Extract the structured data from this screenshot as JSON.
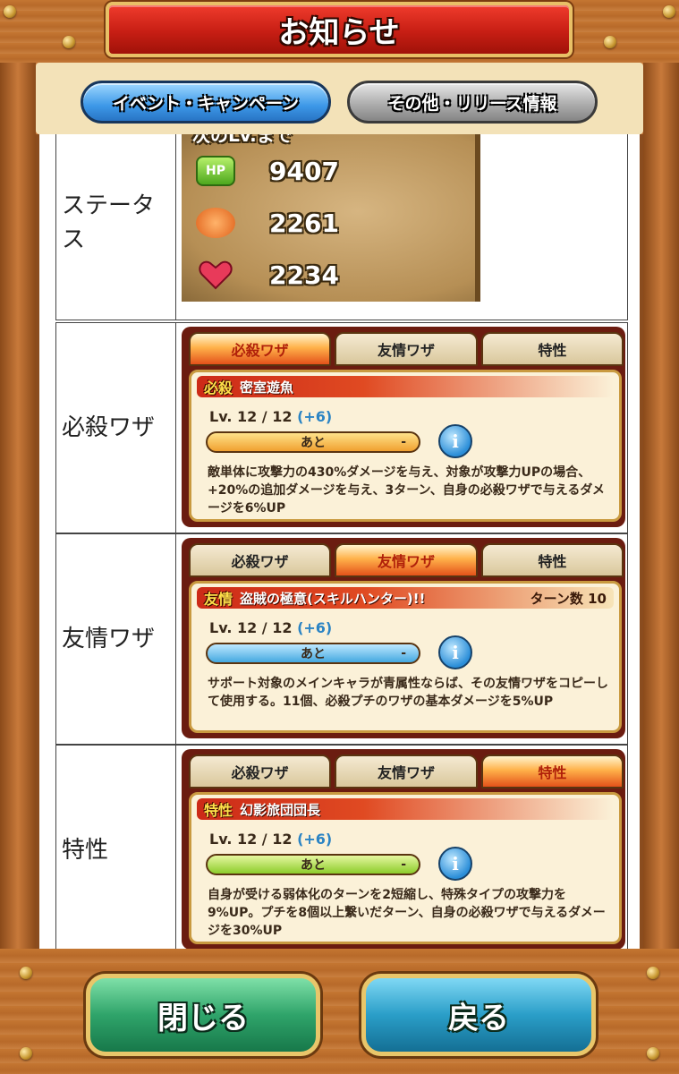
{
  "header": {
    "title": "お知らせ"
  },
  "tabs": [
    {
      "label": "イベント・キャンペーン",
      "active": true
    },
    {
      "label": "その他・リリース情報",
      "active": false
    }
  ],
  "status_row": {
    "label": "ステータス",
    "next_lv": "次のLv.まで",
    "next_lv_value": "-",
    "stats": [
      {
        "icon": "hp-icon",
        "icon_text": "HP",
        "value": "9407"
      },
      {
        "icon": "attack-fist-icon",
        "icon_text": "",
        "value": "2261"
      },
      {
        "icon": "heart-icon",
        "icon_text": "",
        "value": "2234"
      }
    ]
  },
  "skill_tabs": [
    "必殺ワザ",
    "友情ワザ",
    "特性"
  ],
  "special_row": {
    "label": "必殺ワザ",
    "badge": "必殺",
    "name": "密室遊魚",
    "lv": "Lv. 12 / 12",
    "plus": "(+6)",
    "bar_text": "あと",
    "bar_dash": "-",
    "desc": "敵単体に攻撃力の430%ダメージを与え、対象が攻撃力UPの場合、+20%の追加ダメージを与え、3ターン、自身の必殺ワザで与えるダメージを6%UP"
  },
  "friend_row": {
    "label": "友情ワザ",
    "badge": "友情",
    "name": "盗賊の極意(スキルハンター)!!",
    "turn": "ターン数 10",
    "lv": "Lv. 12 / 12",
    "plus": "(+6)",
    "bar_text": "あと",
    "bar_dash": "-",
    "desc": "サポート対象のメインキャラが青属性ならば、その友情ワザをコピーして使用する。11個、必殺プチのワザの基本ダメージを5%UP"
  },
  "trait_row": {
    "label": "特性",
    "badge": "特性",
    "name": "幻影旅団団長",
    "lv": "Lv. 12 / 12",
    "plus": "(+6)",
    "bar_text": "あと",
    "bar_dash": "-",
    "desc": "自身が受ける弱体化のターンを2短縮し、特殊タイプの攻撃力を9%UP。プチを8個以上繋いだターン、自身の必殺ワザで与えるダメージを30%UP"
  },
  "footer": {
    "close_label": "閉じる",
    "back_label": "戻る"
  },
  "info_glyph": "i"
}
